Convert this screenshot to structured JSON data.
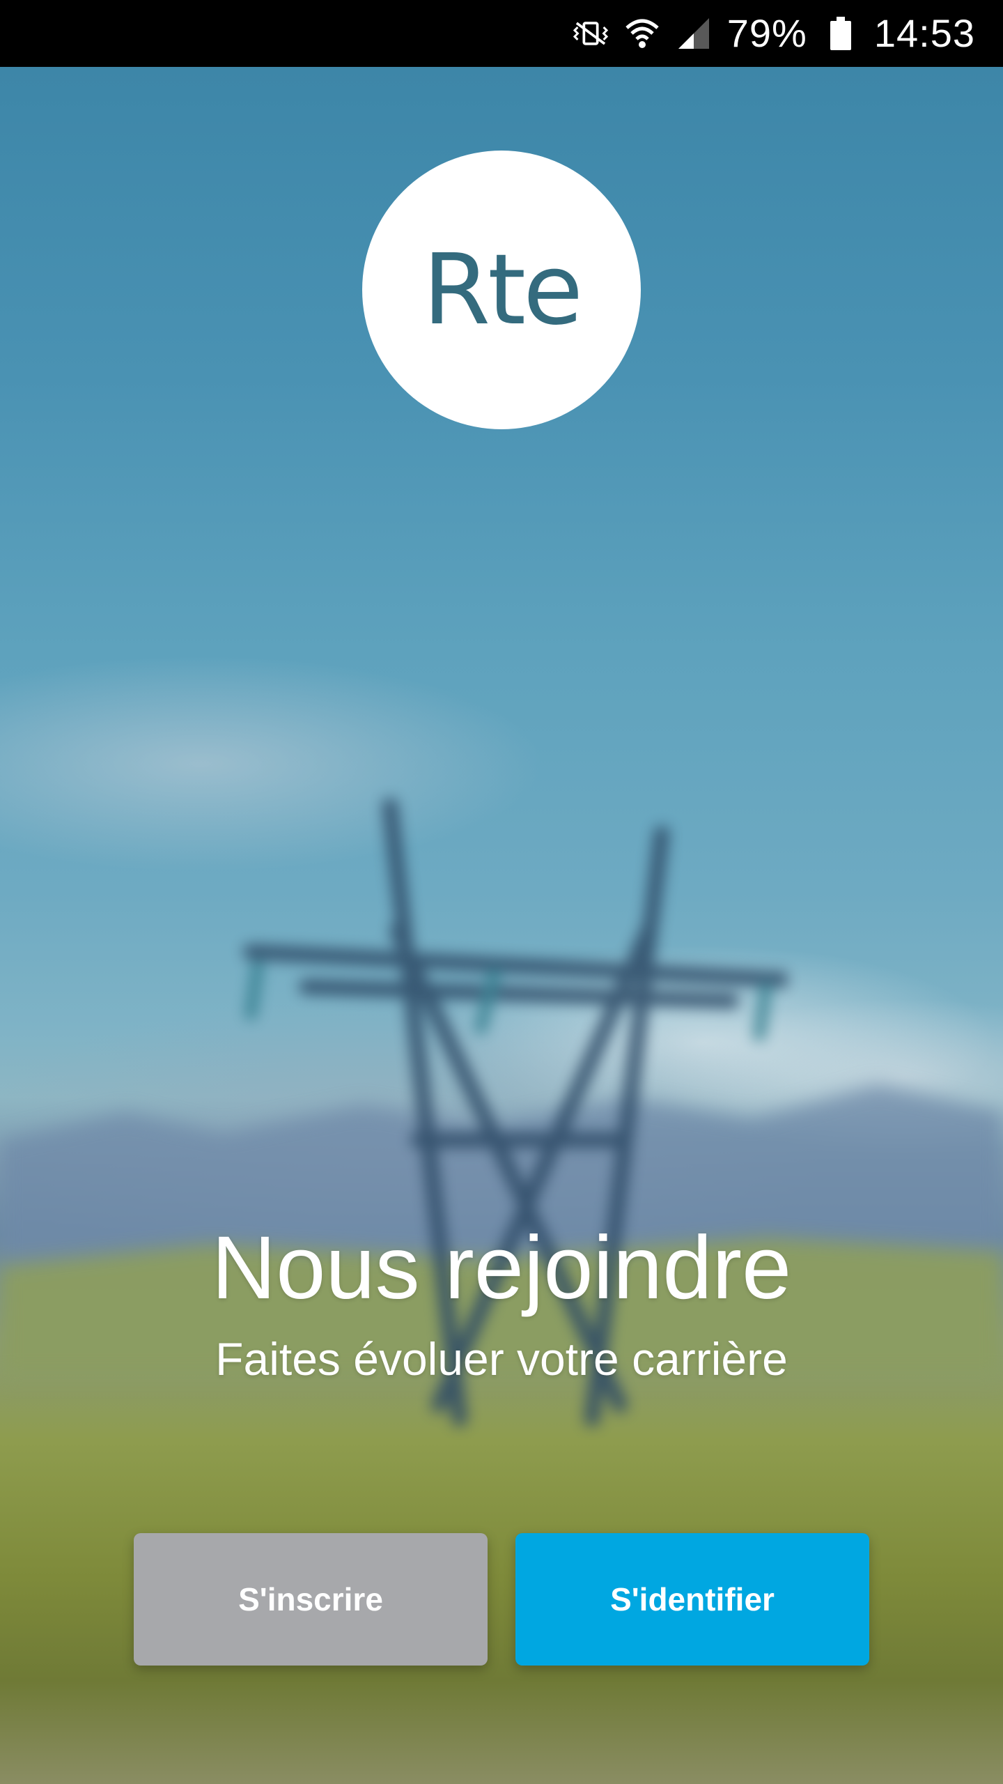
{
  "status_bar": {
    "battery": "79%",
    "time": "14:53",
    "icons": [
      "vibrate-mute-icon",
      "wifi-icon",
      "signal-icon",
      "battery-icon"
    ]
  },
  "logo": {
    "text": "Rte"
  },
  "hero": {
    "title": "Nous rejoindre",
    "subtitle": "Faites évoluer votre carrière"
  },
  "actions": {
    "register_label": "S'inscrire",
    "login_label": "S'identifier"
  },
  "colors": {
    "logo_text": "#346b7e",
    "register_button": "#a7a8ab",
    "login_button": "#00a7e1"
  }
}
